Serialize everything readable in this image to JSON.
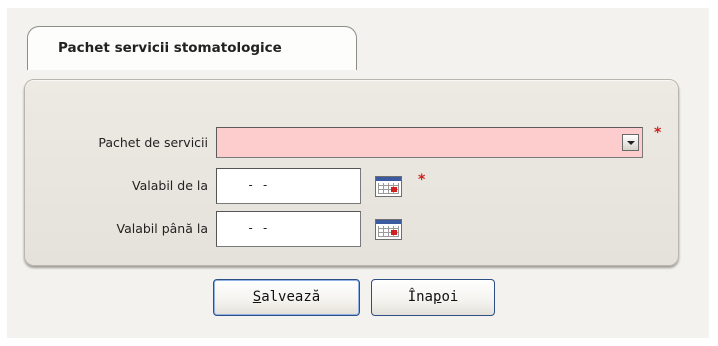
{
  "form": {
    "tab_label": "Pachet servicii stomatologice",
    "fields": {
      "package_label": "Pachet de servicii",
      "package_value": "",
      "valid_from_label": "Valabil de la",
      "valid_from_value": "- -",
      "valid_to_label": "Valabil până la",
      "valid_to_value": "- -"
    },
    "required_marker": "*"
  },
  "buttons": {
    "save_before": "",
    "save_mnemonic": "S",
    "save_after": "alvează",
    "back_before": "Îna",
    "back_mnemonic": "p",
    "back_after": "oi"
  },
  "icons": {
    "dropdown": "chevron-down-icon",
    "calendar": "calendar-icon"
  },
  "colors": {
    "required_field_bg": "#fdcccc",
    "required_marker": "#d02020",
    "button_border": "#2d4f86"
  }
}
